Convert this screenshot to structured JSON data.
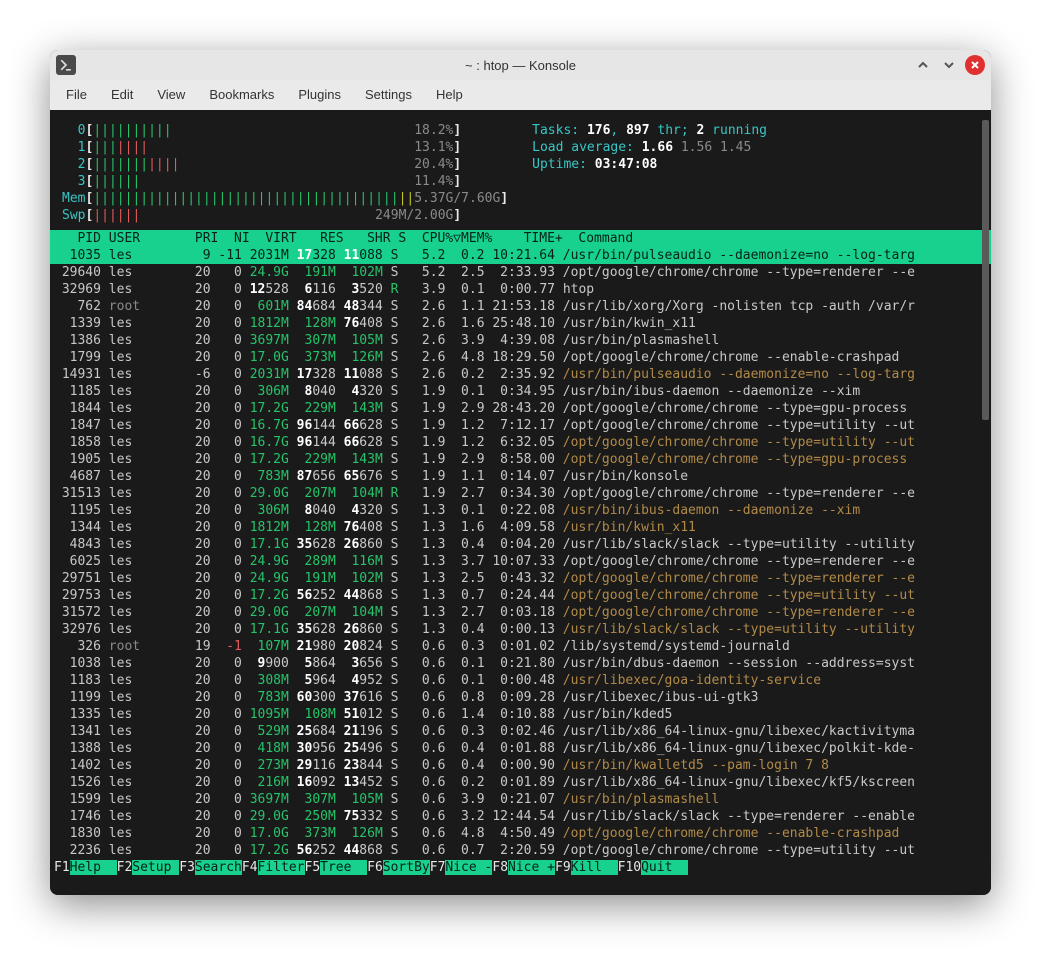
{
  "window": {
    "title": "~ : htop — Konsole"
  },
  "menubar": [
    "File",
    "Edit",
    "View",
    "Bookmarks",
    "Plugins",
    "Settings",
    "Help"
  ],
  "cpu_meters": [
    {
      "id": "0",
      "bars": "||||||||||",
      "bars_red": "",
      "pct": "18.2%"
    },
    {
      "id": "1",
      "bars": "|||",
      "bars_red": "||||",
      "pct": "13.1%"
    },
    {
      "id": "2",
      "bars": "|||||||",
      "bars_red": "||||",
      "pct": "20.4%"
    },
    {
      "id": "3",
      "bars": "||||||",
      "bars_red": "",
      "pct": "11.4%"
    }
  ],
  "mem": {
    "label": "Mem",
    "bars": "|||||||||||||||||||||||||||||||||||||||",
    "bars_yel": "||",
    "used": "5.37G",
    "total": "7.60G"
  },
  "swp": {
    "label": "Swp",
    "bars": "||||||",
    "used": "249M",
    "total": "2.00G"
  },
  "summary": {
    "tasks_label": "Tasks:",
    "tasks": "176",
    "thr": "897",
    "thr_suffix": " thr; ",
    "running": "2",
    "running_suffix": " running",
    "load_label": "Load average:",
    "load1": "1.66",
    "load5": "1.56",
    "load15": "1.45",
    "uptime_label": "Uptime:",
    "uptime": "03:47:08"
  },
  "columns": "   PID USER       PRI  NI  VIRT   RES   SHR S  CPU%▽MEM%    TIME+  Command",
  "processes": [
    {
      "sel": true,
      "pid": "1035",
      "user": "les",
      "pri": "9",
      "ni": "-11",
      "virt": "2031M",
      "res": "17328",
      "resHL": true,
      "shr": "11088",
      "shrHL": true,
      "s": "S",
      "cpu": "5.2",
      "mem": "0.2",
      "time": "10:21.64",
      "cmd": "/usr/bin/pulseaudio --daemonize=no --log-targ",
      "cmdstyle": ""
    },
    {
      "pid": "29640",
      "user": "les",
      "pri": "20",
      "ni": "0",
      "virt": "24.9G",
      "virtG": true,
      "res": "191M",
      "resM": true,
      "shr": "102M",
      "shrM": true,
      "s": "S",
      "cpu": "5.2",
      "mem": "2.5",
      "time": "2:33.93",
      "cmd": "/opt/google/chrome/chrome --type=renderer --e",
      "cmdstyle": ""
    },
    {
      "pid": "32969",
      "user": "les",
      "pri": "20",
      "ni": "0",
      "virt": "12528",
      "virtHL": true,
      "res": "6116",
      "resHL": true,
      "shr": "3520",
      "shrHL": true,
      "s": "R",
      "sR": true,
      "cpu": "3.9",
      "mem": "0.1",
      "time": "0:00.77",
      "cmd": "htop",
      "cmdstyle": ""
    },
    {
      "pid": "762",
      "user": "root",
      "userroot": true,
      "pri": "20",
      "ni": "0",
      "virt": "601M",
      "virtM": true,
      "res": "84684",
      "resHL": true,
      "shr": "48344",
      "shrHL": true,
      "s": "S",
      "cpu": "2.6",
      "mem": "1.1",
      "time": "21:53.18",
      "cmd": "/usr/lib/xorg/Xorg -nolisten tcp -auth /var/r",
      "cmdstyle": ""
    },
    {
      "pid": "1339",
      "user": "les",
      "pri": "20",
      "ni": "0",
      "virt": "1812M",
      "virtM": true,
      "res": "128M",
      "resM": true,
      "shr": "76408",
      "shrHL": true,
      "s": "S",
      "cpu": "2.6",
      "mem": "1.6",
      "time": "25:48.10",
      "cmd": "/usr/bin/kwin_x11",
      "cmdstyle": ""
    },
    {
      "pid": "1386",
      "user": "les",
      "pri": "20",
      "ni": "0",
      "virt": "3697M",
      "virtM": true,
      "res": "307M",
      "resM": true,
      "shr": "105M",
      "shrM": true,
      "s": "S",
      "cpu": "2.6",
      "mem": "3.9",
      "time": "4:39.08",
      "cmd": "/usr/bin/plasmashell",
      "cmdstyle": ""
    },
    {
      "pid": "1799",
      "user": "les",
      "pri": "20",
      "ni": "0",
      "virt": "17.0G",
      "virtG": true,
      "res": "373M",
      "resM": true,
      "shr": "126M",
      "shrM": true,
      "s": "S",
      "cpu": "2.6",
      "mem": "4.8",
      "time": "18:29.50",
      "cmd": "/opt/google/chrome/chrome --enable-crashpad",
      "cmdstyle": ""
    },
    {
      "pid": "14931",
      "user": "les",
      "pri": "-6",
      "ni": "0",
      "virt": "2031M",
      "virtM": true,
      "res": "17328",
      "resHL": true,
      "shr": "11088",
      "shrHL": true,
      "s": "S",
      "cpu": "2.6",
      "mem": "0.2",
      "time": "2:35.92",
      "cmd": "/usr/bin/pulseaudio --daemonize=no --log-targ",
      "cmdstyle": "brown"
    },
    {
      "pid": "1185",
      "user": "les",
      "pri": "20",
      "ni": "0",
      "virt": "306M",
      "virtM": true,
      "res": "8040",
      "resHL": true,
      "shr": "4320",
      "shrHL": true,
      "s": "S",
      "cpu": "1.9",
      "mem": "0.1",
      "time": "0:34.95",
      "cmd": "/usr/bin/ibus-daemon --daemonize --xim",
      "cmdstyle": ""
    },
    {
      "pid": "1844",
      "user": "les",
      "pri": "20",
      "ni": "0",
      "virt": "17.2G",
      "virtG": true,
      "res": "229M",
      "resM": true,
      "shr": "143M",
      "shrM": true,
      "s": "S",
      "cpu": "1.9",
      "mem": "2.9",
      "time": "28:43.20",
      "cmd": "/opt/google/chrome/chrome --type=gpu-process",
      "cmdstyle": ""
    },
    {
      "pid": "1847",
      "user": "les",
      "pri": "20",
      "ni": "0",
      "virt": "16.7G",
      "virtG": true,
      "res": "96144",
      "resHL": true,
      "shr": "66628",
      "shrHL": true,
      "s": "S",
      "cpu": "1.9",
      "mem": "1.2",
      "time": "7:12.17",
      "cmd": "/opt/google/chrome/chrome --type=utility --ut",
      "cmdstyle": ""
    },
    {
      "pid": "1858",
      "user": "les",
      "pri": "20",
      "ni": "0",
      "virt": "16.7G",
      "virtG": true,
      "res": "96144",
      "resHL": true,
      "shr": "66628",
      "shrHL": true,
      "s": "S",
      "cpu": "1.9",
      "mem": "1.2",
      "time": "6:32.05",
      "cmd": "/opt/google/chrome/chrome --type=utility --ut",
      "cmdstyle": "brown"
    },
    {
      "pid": "1905",
      "user": "les",
      "pri": "20",
      "ni": "0",
      "virt": "17.2G",
      "virtG": true,
      "res": "229M",
      "resM": true,
      "shr": "143M",
      "shrM": true,
      "s": "S",
      "cpu": "1.9",
      "mem": "2.9",
      "time": "8:58.00",
      "cmd": "/opt/google/chrome/chrome --type=gpu-process",
      "cmdstyle": "brown"
    },
    {
      "pid": "4687",
      "user": "les",
      "pri": "20",
      "ni": "0",
      "virt": "783M",
      "virtM": true,
      "res": "87656",
      "resHL": true,
      "shr": "65676",
      "shrHL": true,
      "s": "S",
      "cpu": "1.9",
      "mem": "1.1",
      "time": "0:14.07",
      "cmd": "/usr/bin/konsole",
      "cmdstyle": ""
    },
    {
      "pid": "31513",
      "user": "les",
      "pri": "20",
      "ni": "0",
      "virt": "29.0G",
      "virtG": true,
      "res": "207M",
      "resM": true,
      "shr": "104M",
      "shrM": true,
      "s": "R",
      "sR": true,
      "cpu": "1.9",
      "mem": "2.7",
      "time": "0:34.30",
      "cmd": "/opt/google/chrome/chrome --type=renderer --e",
      "cmdstyle": ""
    },
    {
      "pid": "1195",
      "user": "les",
      "pri": "20",
      "ni": "0",
      "virt": "306M",
      "virtM": true,
      "res": "8040",
      "resHL": true,
      "shr": "4320",
      "shrHL": true,
      "s": "S",
      "cpu": "1.3",
      "mem": "0.1",
      "time": "0:22.08",
      "cmd": "/usr/bin/ibus-daemon --daemonize --xim",
      "cmdstyle": "brown"
    },
    {
      "pid": "1344",
      "user": "les",
      "pri": "20",
      "ni": "0",
      "virt": "1812M",
      "virtM": true,
      "res": "128M",
      "resM": true,
      "shr": "76408",
      "shrHL": true,
      "s": "S",
      "cpu": "1.3",
      "mem": "1.6",
      "time": "4:09.58",
      "cmd": "/usr/bin/kwin_x11",
      "cmdstyle": "brown"
    },
    {
      "pid": "4843",
      "user": "les",
      "pri": "20",
      "ni": "0",
      "virt": "17.1G",
      "virtG": true,
      "res": "35628",
      "resHL": true,
      "shr": "26860",
      "shrHL": true,
      "s": "S",
      "cpu": "1.3",
      "mem": "0.4",
      "time": "0:04.20",
      "cmd": "/usr/lib/slack/slack --type=utility --utility",
      "cmdstyle": ""
    },
    {
      "pid": "6025",
      "user": "les",
      "pri": "20",
      "ni": "0",
      "virt": "24.9G",
      "virtG": true,
      "res": "289M",
      "resM": true,
      "shr": "116M",
      "shrM": true,
      "s": "S",
      "cpu": "1.3",
      "mem": "3.7",
      "time": "10:07.33",
      "cmd": "/opt/google/chrome/chrome --type=renderer --e",
      "cmdstyle": ""
    },
    {
      "pid": "29751",
      "user": "les",
      "pri": "20",
      "ni": "0",
      "virt": "24.9G",
      "virtG": true,
      "res": "191M",
      "resM": true,
      "shr": "102M",
      "shrM": true,
      "s": "S",
      "cpu": "1.3",
      "mem": "2.5",
      "time": "0:43.32",
      "cmd": "/opt/google/chrome/chrome --type=renderer --e",
      "cmdstyle": "brown"
    },
    {
      "pid": "29753",
      "user": "les",
      "pri": "20",
      "ni": "0",
      "virt": "17.2G",
      "virtG": true,
      "res": "56252",
      "resHL": true,
      "shr": "44868",
      "shrHL": true,
      "s": "S",
      "cpu": "1.3",
      "mem": "0.7",
      "time": "0:24.44",
      "cmd": "/opt/google/chrome/chrome --type=utility --ut",
      "cmdstyle": "brown"
    },
    {
      "pid": "31572",
      "user": "les",
      "pri": "20",
      "ni": "0",
      "virt": "29.0G",
      "virtG": true,
      "res": "207M",
      "resM": true,
      "shr": "104M",
      "shrM": true,
      "s": "S",
      "cpu": "1.3",
      "mem": "2.7",
      "time": "0:03.18",
      "cmd": "/opt/google/chrome/chrome --type=renderer --e",
      "cmdstyle": "brown"
    },
    {
      "pid": "32976",
      "user": "les",
      "pri": "20",
      "ni": "0",
      "virt": "17.1G",
      "virtG": true,
      "res": "35628",
      "resHL": true,
      "shr": "26860",
      "shrHL": true,
      "s": "S",
      "cpu": "1.3",
      "mem": "0.4",
      "time": "0:00.13",
      "cmd": "/usr/lib/slack/slack --type=utility --utility",
      "cmdstyle": "brown"
    },
    {
      "pid": "326",
      "user": "root",
      "userroot": true,
      "pri": "19",
      "ni": "-1",
      "niR": true,
      "virt": "107M",
      "virtM": true,
      "res": "21980",
      "resHL": true,
      "shr": "20824",
      "shrHL": true,
      "s": "S",
      "cpu": "0.6",
      "mem": "0.3",
      "time": "0:01.02",
      "cmd": "/lib/systemd/systemd-journald",
      "cmdstyle": ""
    },
    {
      "pid": "1038",
      "user": "les",
      "pri": "20",
      "ni": "0",
      "virt": "9900",
      "virtHL": true,
      "res": "5864",
      "resHL": true,
      "shr": "3656",
      "shrHL": true,
      "s": "S",
      "cpu": "0.6",
      "mem": "0.1",
      "time": "0:21.80",
      "cmd": "/usr/bin/dbus-daemon --session --address=syst",
      "cmdstyle": ""
    },
    {
      "pid": "1183",
      "user": "les",
      "pri": "20",
      "ni": "0",
      "virt": "308M",
      "virtM": true,
      "res": "5964",
      "resHL": true,
      "shr": "4952",
      "shrHL": true,
      "s": "S",
      "cpu": "0.6",
      "mem": "0.1",
      "time": "0:00.48",
      "cmd": "/usr/libexec/goa-identity-service",
      "cmdstyle": "brown"
    },
    {
      "pid": "1199",
      "user": "les",
      "pri": "20",
      "ni": "0",
      "virt": "783M",
      "virtM": true,
      "res": "60300",
      "resHL": true,
      "shr": "37616",
      "shrHL": true,
      "s": "S",
      "cpu": "0.6",
      "mem": "0.8",
      "time": "0:09.28",
      "cmd": "/usr/libexec/ibus-ui-gtk3",
      "cmdstyle": ""
    },
    {
      "pid": "1335",
      "user": "les",
      "pri": "20",
      "ni": "0",
      "virt": "1095M",
      "virtM": true,
      "res": "108M",
      "resM": true,
      "shr": "51012",
      "shrHL": true,
      "s": "S",
      "cpu": "0.6",
      "mem": "1.4",
      "time": "0:10.88",
      "cmd": "/usr/bin/kded5",
      "cmdstyle": ""
    },
    {
      "pid": "1341",
      "user": "les",
      "pri": "20",
      "ni": "0",
      "virt": "529M",
      "virtM": true,
      "res": "25684",
      "resHL": true,
      "shr": "21196",
      "shrHL": true,
      "s": "S",
      "cpu": "0.6",
      "mem": "0.3",
      "time": "0:02.46",
      "cmd": "/usr/lib/x86_64-linux-gnu/libexec/kactivityma",
      "cmdstyle": ""
    },
    {
      "pid": "1388",
      "user": "les",
      "pri": "20",
      "ni": "0",
      "virt": "418M",
      "virtM": true,
      "res": "30956",
      "resHL": true,
      "shr": "25496",
      "shrHL": true,
      "s": "S",
      "cpu": "0.6",
      "mem": "0.4",
      "time": "0:01.88",
      "cmd": "/usr/lib/x86_64-linux-gnu/libexec/polkit-kde-",
      "cmdstyle": ""
    },
    {
      "pid": "1402",
      "user": "les",
      "pri": "20",
      "ni": "0",
      "virt": "273M",
      "virtM": true,
      "res": "29116",
      "resHL": true,
      "shr": "23844",
      "shrHL": true,
      "s": "S",
      "cpu": "0.6",
      "mem": "0.4",
      "time": "0:00.90",
      "cmd": "/usr/bin/kwalletd5 --pam-login 7 8",
      "cmdstyle": "brown"
    },
    {
      "pid": "1526",
      "user": "les",
      "pri": "20",
      "ni": "0",
      "virt": "216M",
      "virtM": true,
      "res": "16092",
      "resHL": true,
      "shr": "13452",
      "shrHL": true,
      "s": "S",
      "cpu": "0.6",
      "mem": "0.2",
      "time": "0:01.89",
      "cmd": "/usr/lib/x86_64-linux-gnu/libexec/kf5/kscreen",
      "cmdstyle": ""
    },
    {
      "pid": "1599",
      "user": "les",
      "pri": "20",
      "ni": "0",
      "virt": "3697M",
      "virtM": true,
      "res": "307M",
      "resM": true,
      "shr": "105M",
      "shrM": true,
      "s": "S",
      "cpu": "0.6",
      "mem": "3.9",
      "time": "0:21.07",
      "cmd": "/usr/bin/plasmashell",
      "cmdstyle": "brown"
    },
    {
      "pid": "1746",
      "user": "les",
      "pri": "20",
      "ni": "0",
      "virt": "29.0G",
      "virtG": true,
      "res": "250M",
      "resM": true,
      "shr": "75332",
      "shrHL": true,
      "s": "S",
      "cpu": "0.6",
      "mem": "3.2",
      "time": "12:44.54",
      "cmd": "/usr/lib/slack/slack --type=renderer --enable",
      "cmdstyle": ""
    },
    {
      "pid": "1830",
      "user": "les",
      "pri": "20",
      "ni": "0",
      "virt": "17.0G",
      "virtG": true,
      "res": "373M",
      "resM": true,
      "shr": "126M",
      "shrM": true,
      "s": "S",
      "cpu": "0.6",
      "mem": "4.8",
      "time": "4:50.49",
      "cmd": "/opt/google/chrome/chrome --enable-crashpad",
      "cmdstyle": "brown"
    },
    {
      "pid": "2236",
      "user": "les",
      "pri": "20",
      "ni": "0",
      "virt": "17.2G",
      "virtG": true,
      "res": "56252",
      "resHL": true,
      "shr": "44868",
      "shrHL": true,
      "s": "S",
      "cpu": "0.6",
      "mem": "0.7",
      "time": "2:20.59",
      "cmd": "/opt/google/chrome/chrome --type=utility --ut",
      "cmdstyle": ""
    }
  ],
  "fkeys": [
    {
      "k": "F1",
      "lab": "Help  "
    },
    {
      "k": "F2",
      "lab": "Setup "
    },
    {
      "k": "F3",
      "lab": "Search"
    },
    {
      "k": "F4",
      "lab": "Filter"
    },
    {
      "k": "F5",
      "lab": "Tree  "
    },
    {
      "k": "F6",
      "lab": "SortBy"
    },
    {
      "k": "F7",
      "lab": "Nice -"
    },
    {
      "k": "F8",
      "lab": "Nice +"
    },
    {
      "k": "F9",
      "lab": "Kill  "
    },
    {
      "k": "F10",
      "lab": "Quit  "
    }
  ]
}
